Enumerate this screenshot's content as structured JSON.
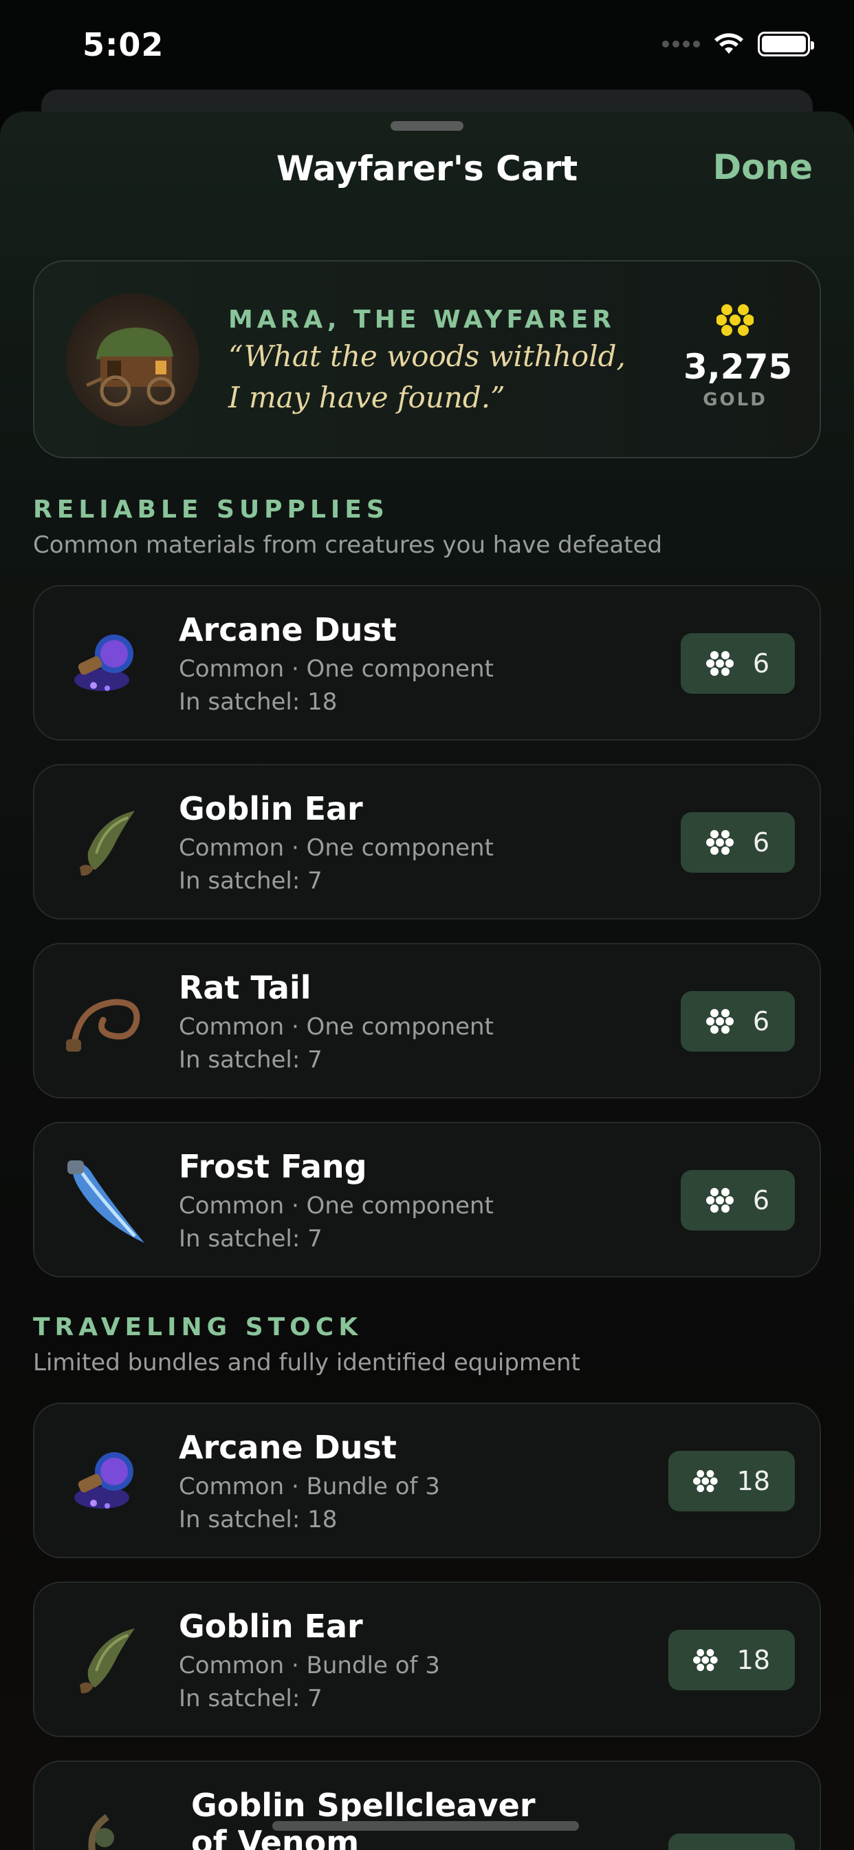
{
  "status_bar": {
    "time": "5:02"
  },
  "sheet": {
    "title": "Wayfarer's Cart",
    "done_label": "Done"
  },
  "merchant": {
    "name": "MARA, THE WAYFARER",
    "quote_line1": "“What the woods withhold,",
    "quote_line2": "I may have found.”",
    "gold_amount": "3,275",
    "gold_label": "GOLD",
    "gold_icon": "gold-coins-icon",
    "gold_color": "#f2d21b"
  },
  "sections": [
    {
      "heading": "RELIABLE SUPPLIES",
      "subtitle": "Common materials from creatures you have defeated"
    },
    {
      "heading": "TRAVELING STOCK",
      "subtitle": "Limited bundles and fully identified equipment"
    }
  ],
  "reliable_items": [
    {
      "name": "Arcane Dust",
      "meta": "Common · One component",
      "satchel": "In satchel: 18",
      "price": "6",
      "icon": "arcane-dust-icon"
    },
    {
      "name": "Goblin Ear",
      "meta": "Common · One component",
      "satchel": "In satchel: 7",
      "price": "6",
      "icon": "goblin-ear-icon"
    },
    {
      "name": "Rat Tail",
      "meta": "Common · One component",
      "satchel": "In satchel: 7",
      "price": "6",
      "icon": "rat-tail-icon"
    },
    {
      "name": "Frost Fang",
      "meta": "Common · One component",
      "satchel": "In satchel: 7",
      "price": "6",
      "icon": "frost-fang-icon"
    }
  ],
  "traveling_items": [
    {
      "name": "Arcane Dust",
      "meta": "Common · Bundle of 3",
      "satchel": "In satchel: 18",
      "price": "18",
      "icon": "arcane-dust-icon"
    },
    {
      "name": "Goblin Ear",
      "meta": "Common · Bundle of 3",
      "satchel": "In satchel: 7",
      "price": "18",
      "icon": "goblin-ear-icon"
    },
    {
      "name_line1": "Goblin Spellcleaver",
      "name_line2": "of Venom",
      "icon": "spellcleaver-icon"
    }
  ],
  "colors": {
    "accent": "#8ac49a",
    "price_button_bg": "#2e4636",
    "quote": "#e6d6a0"
  }
}
